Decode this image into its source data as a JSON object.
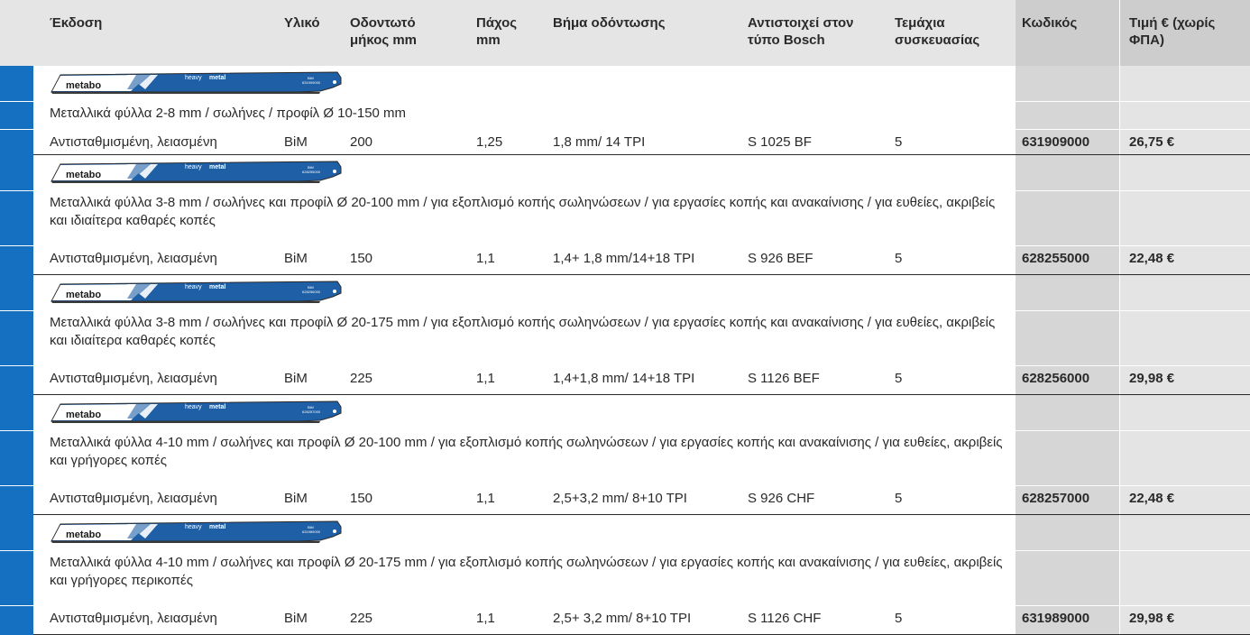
{
  "header": {
    "version": "Έκδοση",
    "material": "Υλικό",
    "tooth_length": "Οδοντωτό μήκος mm",
    "thickness": "Πάχος mm",
    "tooth_pitch": "Βήμα οδόντωσης",
    "bosch_equiv": "Αντιστοιχεί στον τύπο Bosch",
    "pack_qty": "Τεμάχια συσκευασίας",
    "code": "Κωδικός",
    "price": "Τιμή € (χωρίς ΦΠΑ)"
  },
  "logo": {
    "brand": "metabo",
    "series_a": "heavy",
    "series_b": "metal",
    "marking": "BiM"
  },
  "colors": {
    "accent_blue": "#1670c2"
  },
  "products": [
    {
      "desc": "Μεταλλικά φύλλα 2-8 mm / σωλήνες / προφίλ Ø 10-150 mm",
      "code_a": "631909000",
      "version": "Αντισταθμισμένη, λειασμένη",
      "material": "BiM",
      "length": "200",
      "thickness": "1,25",
      "pitch": "1,8 mm/ 14 TPI",
      "bosch": "S 1025 BF",
      "qty": "5",
      "code": "631909000",
      "price": "26,75 €"
    },
    {
      "desc": "Μεταλλικά φύλλα 3-8 mm / σωλήνες και προφίλ Ø 20-100 mm / για εξοπλισμό κοπής σωληνώσεων / για εργασίες κοπής και ανακαίνισης / για ευθείες, ακριβείς και ιδιαίτερα καθαρές κοπές",
      "code_a": "628255000",
      "version": "Αντισταθμισμένη, λειασμένη",
      "material": "BiM",
      "length": "150",
      "thickness": "1,1",
      "pitch": "1,4+ 1,8 mm/14+18 TPI",
      "bosch": "S 926 BEF",
      "qty": "5",
      "code": "628255000",
      "price": "22,48 €"
    },
    {
      "desc": "Μεταλλικά φύλλα 3-8 mm / σωλήνες και προφίλ Ø 20-175 mm / για εξοπλισμό κοπής σωληνώσεων / για εργασίες κοπής και ανακαίνισης / για ευθείες, ακριβείς και ιδιαίτερα καθαρές κοπές",
      "code_a": "628256000",
      "version": "Αντισταθμισμένη, λειασμένη",
      "material": "BiM",
      "length": "225",
      "thickness": "1,1",
      "pitch": "1,4+1,8 mm/ 14+18 TPI",
      "bosch": "S 1126 BEF",
      "qty": "5",
      "code": "628256000",
      "price": "29,98 €"
    },
    {
      "desc": "Μεταλλικά φύλλα 4-10 mm / σωλήνες και προφίλ Ø 20-100 mm / για εξοπλισμό κοπής σωληνώσεων / για εργασίες κοπής και ανακαίνισης / για ευθείες, ακριβείς και γρήγορες κοπές",
      "code_a": "628257000",
      "version": "Αντισταθμισμένη, λειασμένη",
      "material": "BiM",
      "length": "150",
      "thickness": "1,1",
      "pitch": "2,5+3,2 mm/ 8+10 TPI",
      "bosch": "S 926 CHF",
      "qty": "5",
      "code": "628257000",
      "price": "22,48 €"
    },
    {
      "desc": "Μεταλλικά φύλλα 4-10 mm / σωλήνες και προφίλ Ø 20-175 mm / για εξοπλισμό κοπής σωληνώσεων / για εργασίες κοπής και ανακαίνισης / για ευθείες, ακριβείς και γρήγορες περικοπές",
      "code_a": "631989000",
      "version": "Αντισταθμισμένη, λειασμένη",
      "material": "BiM",
      "length": "225",
      "thickness": "1,1",
      "pitch": "2,5+ 3,2 mm/ 8+10 TPI",
      "bosch": "S 1126 CHF",
      "qty": "5",
      "code": "631989000",
      "price": "29,98 €"
    }
  ]
}
